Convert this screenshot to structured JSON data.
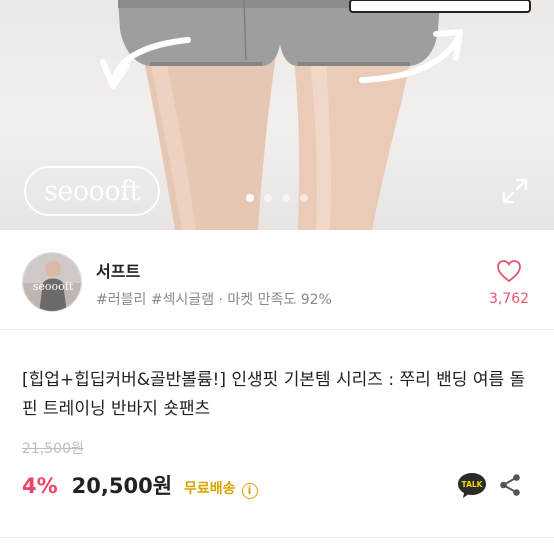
{
  "hero": {
    "watermark": "seoooft",
    "slides": 4,
    "active_slide": 1,
    "icons": [
      "arrow-left-curve-icon",
      "arrow-right-curve-icon",
      "expand-icon"
    ]
  },
  "seller": {
    "name": "서프트",
    "avatar_text": "seoooft",
    "tags": "#러블리 #섹시글램 · 마켓 만족도 92%",
    "like_count": "3,762",
    "like_color": "#e4556e"
  },
  "product": {
    "title": "[힙업+힙딥커버&골반볼륨!] 인생핏 기본템 시리즈 : 쭈리 밴딩 여름 돌핀 트레이닝 반바지 숏팬츠",
    "original_price": "21,500원",
    "discount": "4%",
    "price": "20,500원",
    "shipping": "무료배송",
    "talk_label": "TALK"
  },
  "colors": {
    "discount": "#f04366",
    "shipping": "#d9a400",
    "talk_bg": "#2b2b2b"
  }
}
